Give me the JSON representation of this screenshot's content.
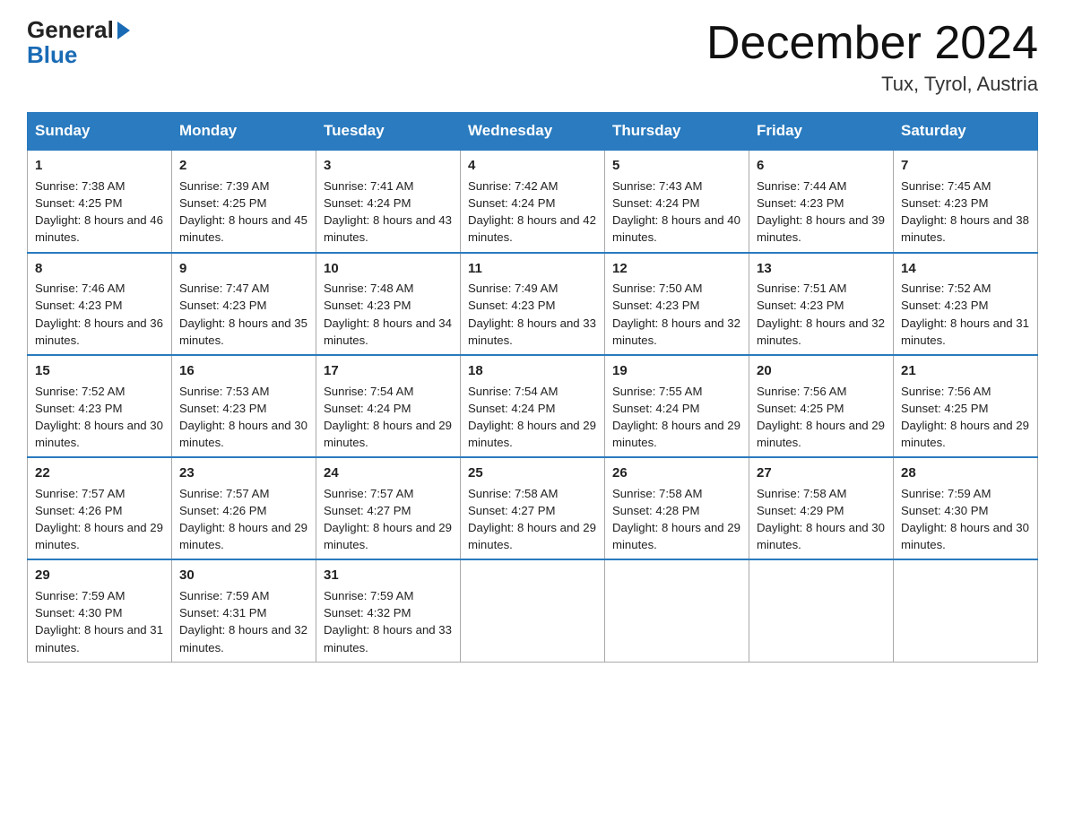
{
  "header": {
    "logo_general": "General",
    "logo_blue": "Blue",
    "month_title": "December 2024",
    "location": "Tux, Tyrol, Austria"
  },
  "days_of_week": [
    "Sunday",
    "Monday",
    "Tuesday",
    "Wednesday",
    "Thursday",
    "Friday",
    "Saturday"
  ],
  "weeks": [
    [
      {
        "day": "1",
        "sunrise": "7:38 AM",
        "sunset": "4:25 PM",
        "daylight": "8 hours and 46 minutes."
      },
      {
        "day": "2",
        "sunrise": "7:39 AM",
        "sunset": "4:25 PM",
        "daylight": "8 hours and 45 minutes."
      },
      {
        "day": "3",
        "sunrise": "7:41 AM",
        "sunset": "4:24 PM",
        "daylight": "8 hours and 43 minutes."
      },
      {
        "day": "4",
        "sunrise": "7:42 AM",
        "sunset": "4:24 PM",
        "daylight": "8 hours and 42 minutes."
      },
      {
        "day": "5",
        "sunrise": "7:43 AM",
        "sunset": "4:24 PM",
        "daylight": "8 hours and 40 minutes."
      },
      {
        "day": "6",
        "sunrise": "7:44 AM",
        "sunset": "4:23 PM",
        "daylight": "8 hours and 39 minutes."
      },
      {
        "day": "7",
        "sunrise": "7:45 AM",
        "sunset": "4:23 PM",
        "daylight": "8 hours and 38 minutes."
      }
    ],
    [
      {
        "day": "8",
        "sunrise": "7:46 AM",
        "sunset": "4:23 PM",
        "daylight": "8 hours and 36 minutes."
      },
      {
        "day": "9",
        "sunrise": "7:47 AM",
        "sunset": "4:23 PM",
        "daylight": "8 hours and 35 minutes."
      },
      {
        "day": "10",
        "sunrise": "7:48 AM",
        "sunset": "4:23 PM",
        "daylight": "8 hours and 34 minutes."
      },
      {
        "day": "11",
        "sunrise": "7:49 AM",
        "sunset": "4:23 PM",
        "daylight": "8 hours and 33 minutes."
      },
      {
        "day": "12",
        "sunrise": "7:50 AM",
        "sunset": "4:23 PM",
        "daylight": "8 hours and 32 minutes."
      },
      {
        "day": "13",
        "sunrise": "7:51 AM",
        "sunset": "4:23 PM",
        "daylight": "8 hours and 32 minutes."
      },
      {
        "day": "14",
        "sunrise": "7:52 AM",
        "sunset": "4:23 PM",
        "daylight": "8 hours and 31 minutes."
      }
    ],
    [
      {
        "day": "15",
        "sunrise": "7:52 AM",
        "sunset": "4:23 PM",
        "daylight": "8 hours and 30 minutes."
      },
      {
        "day": "16",
        "sunrise": "7:53 AM",
        "sunset": "4:23 PM",
        "daylight": "8 hours and 30 minutes."
      },
      {
        "day": "17",
        "sunrise": "7:54 AM",
        "sunset": "4:24 PM",
        "daylight": "8 hours and 29 minutes."
      },
      {
        "day": "18",
        "sunrise": "7:54 AM",
        "sunset": "4:24 PM",
        "daylight": "8 hours and 29 minutes."
      },
      {
        "day": "19",
        "sunrise": "7:55 AM",
        "sunset": "4:24 PM",
        "daylight": "8 hours and 29 minutes."
      },
      {
        "day": "20",
        "sunrise": "7:56 AM",
        "sunset": "4:25 PM",
        "daylight": "8 hours and 29 minutes."
      },
      {
        "day": "21",
        "sunrise": "7:56 AM",
        "sunset": "4:25 PM",
        "daylight": "8 hours and 29 minutes."
      }
    ],
    [
      {
        "day": "22",
        "sunrise": "7:57 AM",
        "sunset": "4:26 PM",
        "daylight": "8 hours and 29 minutes."
      },
      {
        "day": "23",
        "sunrise": "7:57 AM",
        "sunset": "4:26 PM",
        "daylight": "8 hours and 29 minutes."
      },
      {
        "day": "24",
        "sunrise": "7:57 AM",
        "sunset": "4:27 PM",
        "daylight": "8 hours and 29 minutes."
      },
      {
        "day": "25",
        "sunrise": "7:58 AM",
        "sunset": "4:27 PM",
        "daylight": "8 hours and 29 minutes."
      },
      {
        "day": "26",
        "sunrise": "7:58 AM",
        "sunset": "4:28 PM",
        "daylight": "8 hours and 29 minutes."
      },
      {
        "day": "27",
        "sunrise": "7:58 AM",
        "sunset": "4:29 PM",
        "daylight": "8 hours and 30 minutes."
      },
      {
        "day": "28",
        "sunrise": "7:59 AM",
        "sunset": "4:30 PM",
        "daylight": "8 hours and 30 minutes."
      }
    ],
    [
      {
        "day": "29",
        "sunrise": "7:59 AM",
        "sunset": "4:30 PM",
        "daylight": "8 hours and 31 minutes."
      },
      {
        "day": "30",
        "sunrise": "7:59 AM",
        "sunset": "4:31 PM",
        "daylight": "8 hours and 32 minutes."
      },
      {
        "day": "31",
        "sunrise": "7:59 AM",
        "sunset": "4:32 PM",
        "daylight": "8 hours and 33 minutes."
      },
      null,
      null,
      null,
      null
    ]
  ]
}
